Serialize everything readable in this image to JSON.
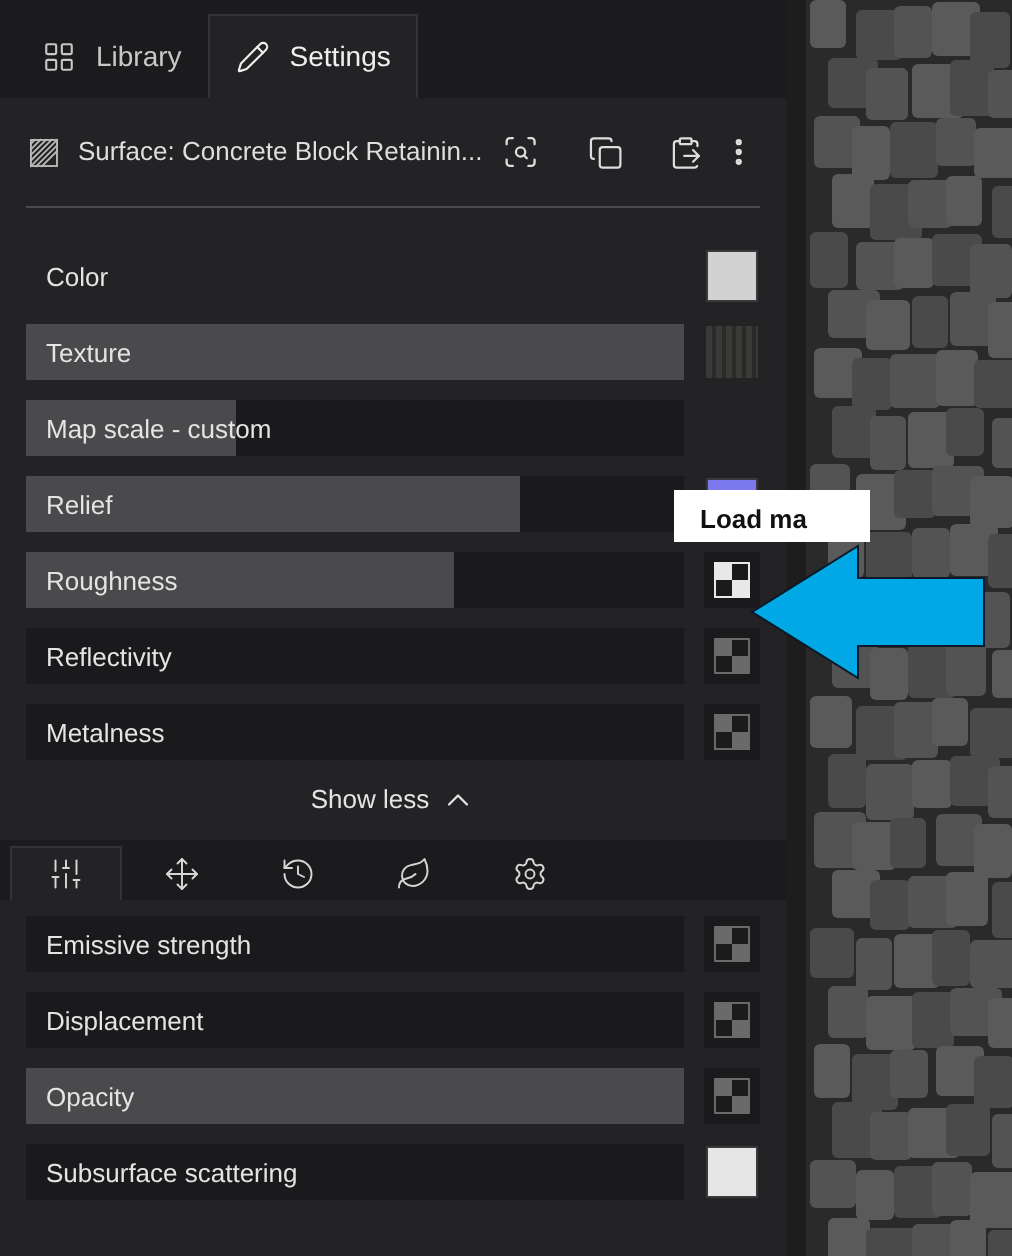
{
  "tabs": [
    {
      "label": "Library",
      "kind": "grid",
      "selected": false
    },
    {
      "label": "Settings",
      "kind": "pencil",
      "selected": true
    }
  ],
  "header": {
    "title": "Surface: Concrete Block Retainin..."
  },
  "properties": [
    {
      "label": "Color",
      "kind": "color-field",
      "color": "#d2d2d2"
    },
    {
      "label": "Texture",
      "level": 1,
      "kind": "texture"
    },
    {
      "label": "Map scale - custom",
      "level": 0.32,
      "kind": "none"
    },
    {
      "label": "Relief",
      "level": 0.75,
      "kind": "color",
      "color": "#7b78ee"
    },
    {
      "label": "Roughness",
      "level": 0.65,
      "kind": "map",
      "selected": true
    },
    {
      "label": "Reflectivity",
      "kind": "map",
      "selected": false
    },
    {
      "label": "Metalness",
      "kind": "map",
      "selected": false
    }
  ],
  "tooltip": {
    "text": "Load ma"
  },
  "toggle": {
    "label": "Show less"
  },
  "tool_tabs": [
    {
      "kind": "sliders",
      "selected": true
    },
    {
      "kind": "move",
      "selected": false
    },
    {
      "kind": "history",
      "selected": false
    },
    {
      "kind": "leaf",
      "selected": false
    },
    {
      "kind": "settings",
      "selected": false
    }
  ],
  "more_properties": [
    {
      "label": "Emissive strength",
      "kind": "map",
      "selected": false
    },
    {
      "label": "Displacement",
      "kind": "map",
      "selected": false
    },
    {
      "label": "Opacity",
      "level": 1,
      "kind": "map",
      "selected": false
    },
    {
      "label": "Subsurface scattering",
      "kind": "color",
      "color": "#e6e6e6"
    }
  ]
}
